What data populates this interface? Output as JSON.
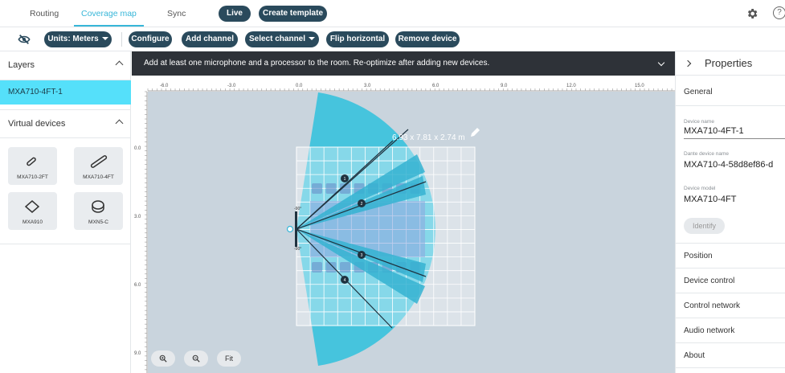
{
  "nav": {
    "tabs": [
      "Routing",
      "Coverage map",
      "Sync"
    ],
    "active_tab": "Coverage map",
    "live_label": "Live",
    "create_template_label": "Create template",
    "icons": [
      "gear-icon",
      "help-icon"
    ]
  },
  "toolbar": {
    "visibility_icon": "eye-off-icon",
    "units_label": "Units: Meters",
    "configure_label": "Configure",
    "add_channel_label": "Add channel",
    "select_channel_label": "Select channel",
    "flip_label": "Flip horizontal",
    "remove_label": "Remove device"
  },
  "left": {
    "layers_title": "Layers",
    "selected_layer": "MXA710-4FT-1",
    "virtual_title": "Virtual devices",
    "devices": [
      "MXA710-2FT",
      "MXA710-4FT",
      "MXA910",
      "MXN5-C"
    ]
  },
  "canvas": {
    "banner": "Add at least one microphone and a processor to the room. Re-optimize after adding new devices.",
    "x_ticks": [
      "-6.0",
      "-3.0",
      "0.0",
      "3.0",
      "6.0",
      "9.0",
      "12.0",
      "15.0"
    ],
    "y_ticks": [
      "0.0",
      "3.0",
      "6.0",
      "9.0"
    ],
    "dimensions": "6.93 x 7.81 x 2.74 m",
    "angle_top": "-90°",
    "angle_bottom": "-90°",
    "lobes": [
      "1",
      "2",
      "3",
      "4"
    ],
    "zoom_in_icon": "zoom-in-icon",
    "zoom_out_icon": "zoom-out-icon",
    "fit_label": "Fit",
    "colors": {
      "coverage": "#3fc3dc",
      "room": "#ffffff",
      "background": "#c9d4dd"
    }
  },
  "right": {
    "title": "Properties",
    "general_label": "General",
    "device_name_label": "Device name",
    "device_name": "MXA710-4FT-1",
    "dante_label": "Dante device name",
    "dante_name": "MXA710-4-58d8ef86-d",
    "model_label": "Device model",
    "model": "MXA710-4FT",
    "identify_label": "Identify",
    "sections": [
      "Position",
      "Device control",
      "Control network",
      "Audio network",
      "About"
    ]
  }
}
